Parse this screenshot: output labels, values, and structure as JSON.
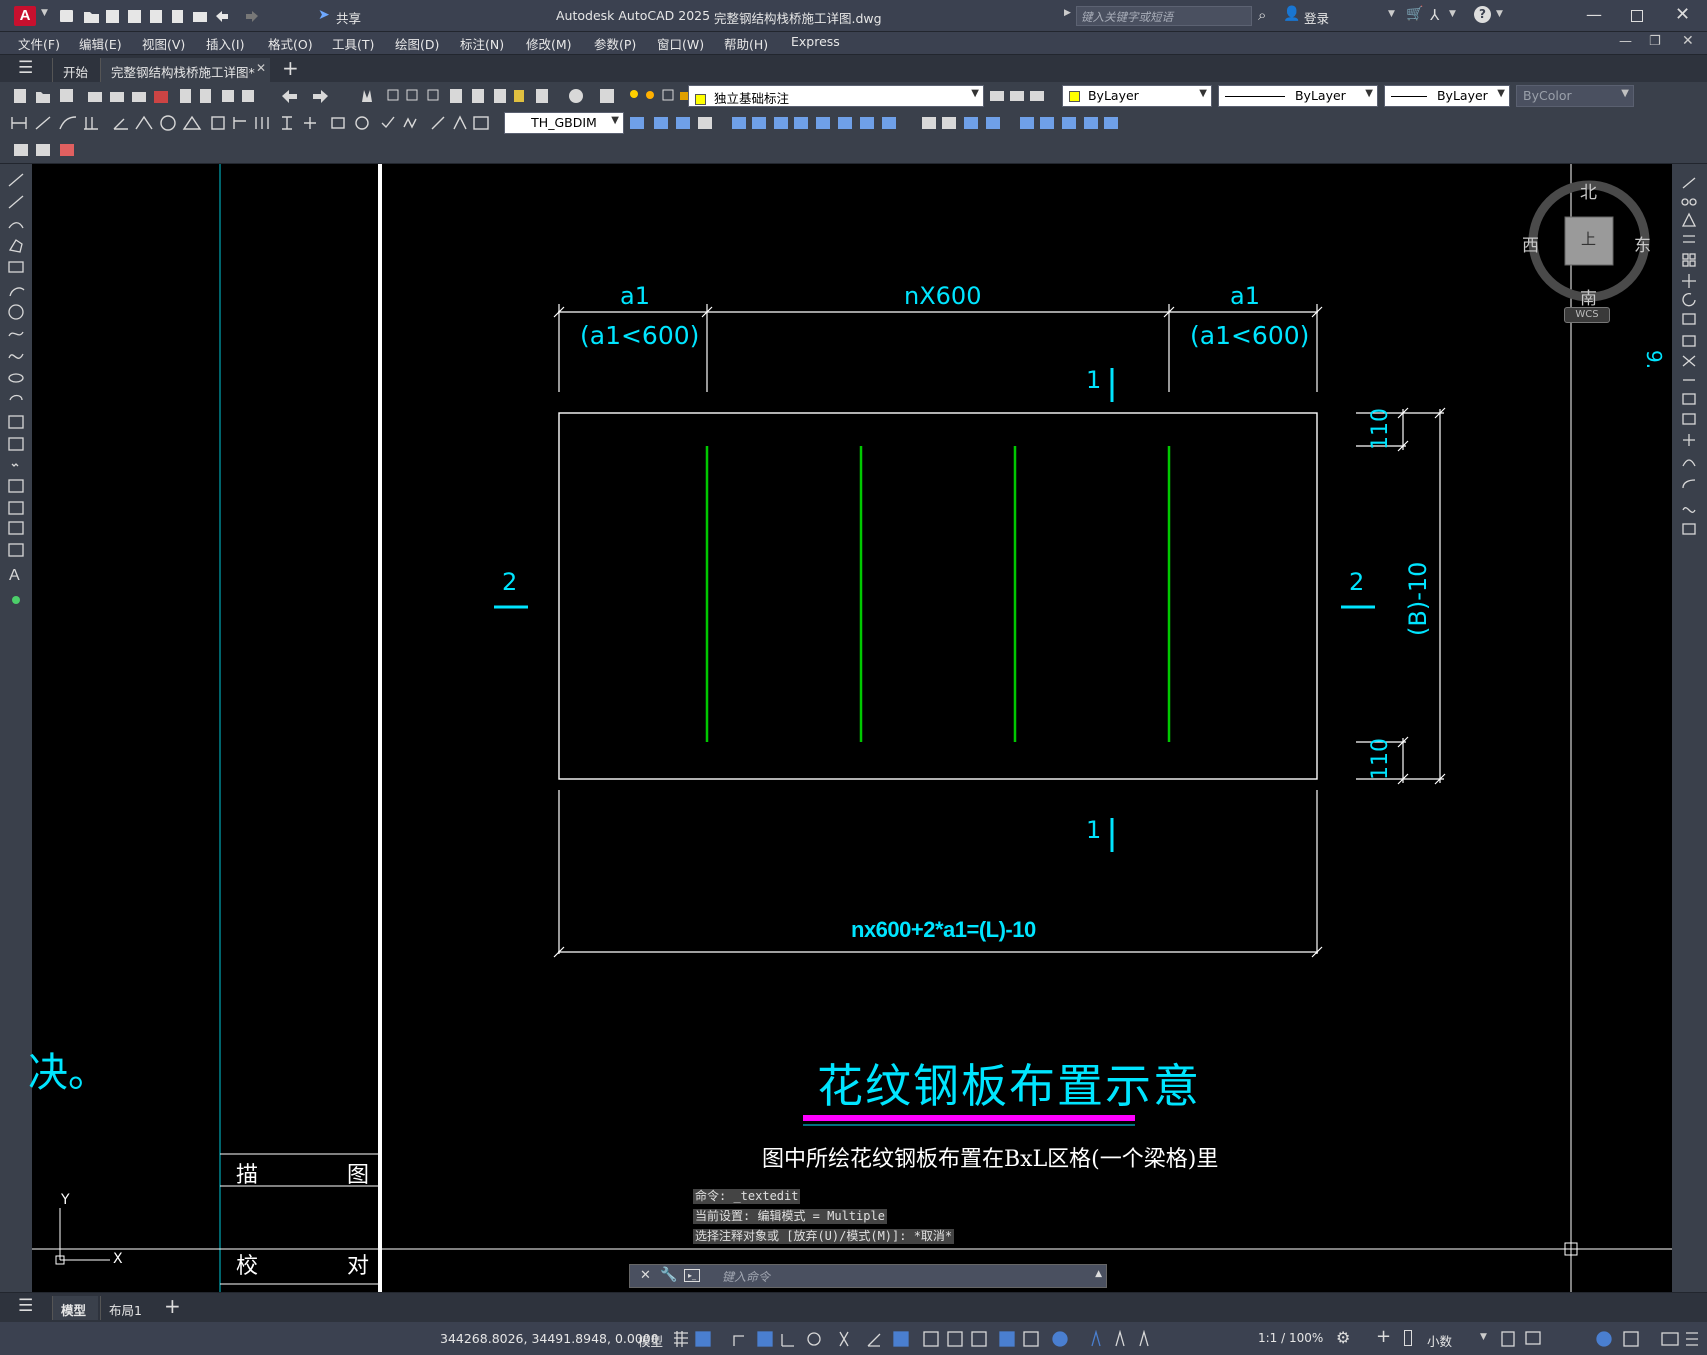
{
  "titlebar": {
    "app_title": "Autodesk AutoCAD 2025",
    "doc_title": "完整钢结构栈桥施工详图.dwg",
    "search_placeholder": "键入关键字或短语",
    "share_label": "共享",
    "login_label": "登录"
  },
  "menu": [
    "文件(F)",
    "编辑(E)",
    "视图(V)",
    "插入(I)",
    "格式(O)",
    "工具(T)",
    "绘图(D)",
    "标注(N)",
    "修改(M)",
    "参数(P)",
    "窗口(W)",
    "帮助(H)",
    "Express"
  ],
  "tabs": {
    "start": "开始",
    "active": "完整钢结构栈桥施工详图*"
  },
  "toolbar": {
    "layer_name": "独立基础标注",
    "color": "ByLayer",
    "linetype": "ByLayer",
    "lineweight": "ByLayer",
    "plotstyle": "ByColor",
    "dimstyle": "TH_GBDIM"
  },
  "viewcube": {
    "north": "北",
    "south": "南",
    "east": "东",
    "west": "西",
    "top": "上",
    "wcs": "WCS"
  },
  "drawing": {
    "dim_a1_left": "a1",
    "dim_a1_left_note": "(a1<600)",
    "dim_nx600": "nX600",
    "dim_a1_right": "a1",
    "dim_a1_right_note": "(a1<600)",
    "section_1_top": "1",
    "section_1_bottom": "1",
    "section_2_left": "2",
    "section_2_right": "2",
    "dim_110_top": "110",
    "dim_110_bottom": "110",
    "dim_b10": "(B)-10",
    "dim_total": "nx600+2*a1=(L)-10",
    "title": "花纹钢板布置示意",
    "note": "图中所绘花纹钢板布置在BxL区格(一个梁格)里",
    "left_fragment": "决。",
    "right_fragment": "9.",
    "title_block_draw_1": "描",
    "title_block_draw_2": "图",
    "title_block_check_1": "校",
    "title_block_check_2": "对"
  },
  "colors": {
    "cyan": "#00e5ff",
    "green": "#00c800",
    "magenta": "#ff00ff",
    "white": "#ffffff"
  },
  "command": {
    "history": [
      "命令: _textedit",
      "当前设置: 编辑模式 = Multiple",
      "选择注释对象或 [放弃(U)/模式(M)]: *取消*"
    ],
    "placeholder": "键入命令"
  },
  "bottom_tabs": {
    "model": "模型",
    "layout1": "布局1"
  },
  "status": {
    "coords": "344268.8026, 34491.8948, 0.0000",
    "model": "模型",
    "scale": "1:1 / 100%",
    "units": "小数"
  }
}
